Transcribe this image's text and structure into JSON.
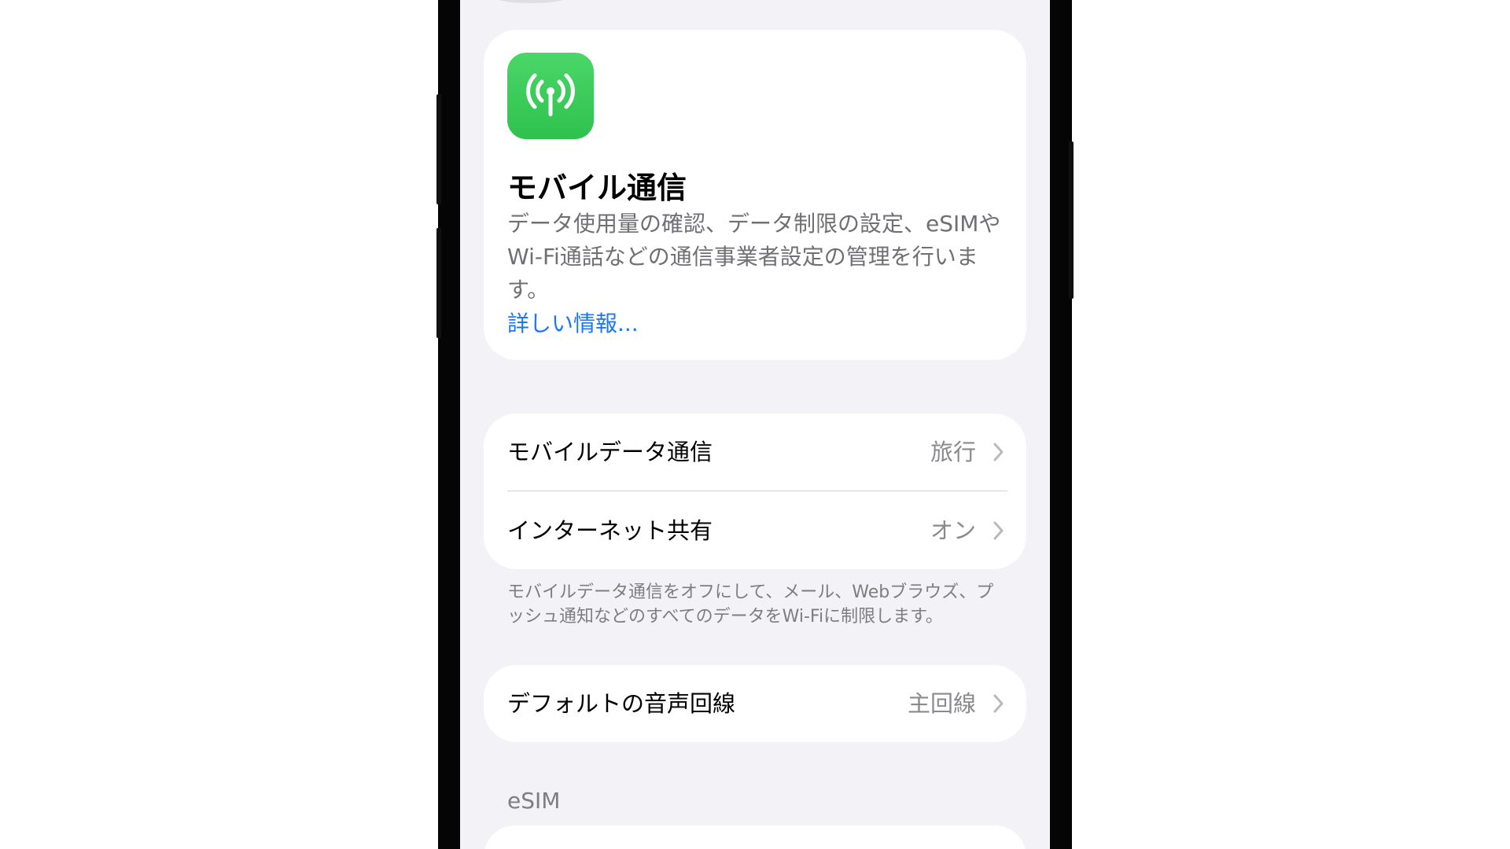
{
  "info_card": {
    "icon": "antenna-radiowaves-icon",
    "icon_color": "#34c759",
    "title": "モバイル通信",
    "description": "データ使用量の確認、データ制限の設定、eSIMやWi-Fi通話などの通信事業者設定の管理を行います。",
    "link": "詳しい情報..."
  },
  "list_1": {
    "rows": [
      {
        "label": "モバイルデータ通信",
        "value": "旅行"
      },
      {
        "label": "インターネット共有",
        "value": "オン"
      }
    ],
    "footer": "モバイルデータ通信をオフにして、メール、Webブラウズ、プッシュ通知などのすべてのデータをWi-Fiに制限します。"
  },
  "list_2": {
    "rows": [
      {
        "label": "デフォルトの音声回線",
        "value": "主回線"
      }
    ]
  },
  "esim_section": {
    "header": "eSIM"
  },
  "colors": {
    "background": "#f2f2f7",
    "card": "#ffffff",
    "link": "#1a78f2",
    "secondary_text": "#8a8a8e"
  }
}
